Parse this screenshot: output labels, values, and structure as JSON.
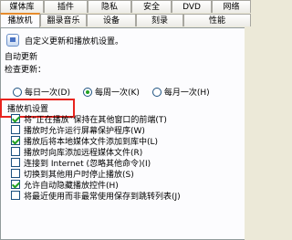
{
  "tabs_back": [
    {
      "label": "媒体库",
      "w": 48
    },
    {
      "label": "插件",
      "w": 48
    },
    {
      "label": "隐私",
      "w": 48
    },
    {
      "label": "安全",
      "w": 44
    },
    {
      "label": "DVD",
      "w": 44
    },
    {
      "label": "网络",
      "w": 43
    }
  ],
  "tabs_front": [
    {
      "label": "播放机",
      "w": 44,
      "active": true
    },
    {
      "label": "翻录音乐",
      "w": 51
    },
    {
      "label": "设备",
      "w": 54
    },
    {
      "label": "刻录",
      "w": 52
    },
    {
      "label": "性能",
      "w": 74
    }
  ],
  "header": {
    "text": "自定义更新和播放机设置。"
  },
  "auto_update": {
    "title": "自动更新",
    "check_label": "检查更新：",
    "options": [
      {
        "label": "每日一次(D)",
        "checked": false
      },
      {
        "label": "每周一次(K)",
        "checked": true
      },
      {
        "label": "每月一次(H)",
        "checked": false
      }
    ]
  },
  "player_settings": {
    "title": "播放机设置",
    "options": [
      {
        "label": "将“正在播放”保持在其他窗口的前端(T)",
        "checked": true
      },
      {
        "label": "播放时允许运行屏幕保护程序(W)",
        "checked": false
      },
      {
        "label": "播放后将本地媒体文件添加到库中(L)",
        "checked": true
      },
      {
        "label": "播放时向库添加远程媒体文件(R)",
        "checked": false
      },
      {
        "label": "连接到 Internet (忽略其他命令)(I)",
        "checked": false
      },
      {
        "label": "切换到其他用户时停止播放(S)",
        "checked": false
      },
      {
        "label": "允许自动隐藏播放控件(H)",
        "checked": true
      },
      {
        "label": "将最近使用而非最常使用保存到跳转列表(J)",
        "checked": false
      }
    ]
  }
}
